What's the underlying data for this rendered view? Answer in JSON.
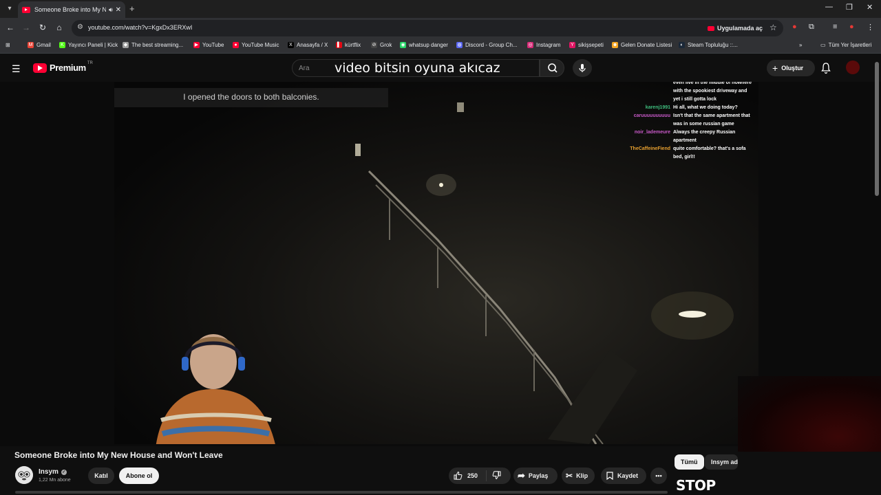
{
  "browser": {
    "tab_title": "Someone Broke into My Ne",
    "url": "youtube.com/watch?v=KgxDx3ERXwI",
    "open_in_app": "Uygulamada aç",
    "bookmarks": [
      {
        "label": "Gmail",
        "color": "#ea4335",
        "icon": "M"
      },
      {
        "label": "Yayıncı Paneli | Kick",
        "color": "#53fc18",
        "icon": "K"
      },
      {
        "label": "The best streaming...",
        "color": "#9e9e9e",
        "icon": "◆"
      },
      {
        "label": "YouTube",
        "color": "#ff0033",
        "icon": "▶"
      },
      {
        "label": "YouTube Music",
        "color": "#ff0033",
        "icon": "●"
      },
      {
        "label": "Anasayfa / X",
        "color": "#000000",
        "icon": "X"
      },
      {
        "label": "kürtflix",
        "color": "#e50914",
        "icon": "▌"
      },
      {
        "label": "Grok",
        "color": "#444444",
        "icon": "⊘"
      },
      {
        "label": "whatsup danger",
        "color": "#25d366",
        "icon": "◉"
      },
      {
        "label": "Discord - Group Ch...",
        "color": "#5865f2",
        "icon": "◍"
      },
      {
        "label": "Instagram",
        "color": "#d62976",
        "icon": "◎"
      },
      {
        "label": "sikişsepeti",
        "color": "#e01563",
        "icon": "Y"
      },
      {
        "label": "Gelen Donate Listesi",
        "color": "#f5a623",
        "icon": "☻"
      },
      {
        "label": "Steam Topluluğu ::...",
        "color": "#1b2838",
        "icon": "◐"
      }
    ],
    "all_bookmarks": "Tüm Yer İşaretleri"
  },
  "youtube": {
    "logo_text": "Premium",
    "country": "TR",
    "search_placeholder": "Ara",
    "search_query": "video bitsin oyuna akıcaz",
    "create_label": "Oluştur"
  },
  "video": {
    "caption": "I opened the doors to both balconies.",
    "chat": [
      {
        "user": "",
        "color": "#ffffff",
        "msg": "even live in the middle of nowhere"
      },
      {
        "user": "",
        "color": "#ffffff",
        "msg": "with the spookiest driveway and"
      },
      {
        "user": "",
        "color": "#ffffff",
        "msg": "yet i still gotta lock"
      },
      {
        "user": "karenj1991",
        "color": "#3fbf7f",
        "msg": "Hi all, what we doing today?"
      },
      {
        "user": "caruuuuuuuuuu",
        "color": "#c85ac8",
        "msg": "Isn't that the same apartment that"
      },
      {
        "user": "",
        "color": "#ffffff",
        "msg": "was in some russian game"
      },
      {
        "user": "noir_lademeure",
        "color": "#c85ac8",
        "msg": "Always the creepy Russian"
      },
      {
        "user": "",
        "color": "#ffffff",
        "msg": "apartment"
      },
      {
        "user": "TheCaffeineFiend",
        "color": "#e8a030",
        "msg": "quite comfortable? that's a sofa"
      },
      {
        "user": "",
        "color": "#ffffff",
        "msg": "bed, girl!!"
      }
    ],
    "title": "Someone Broke into My New House and Won't Leave",
    "channel": "Insym",
    "subscribers": "1,22 Mn abone",
    "join_label": "Katıl",
    "subscribe_label": "Abone ol",
    "likes": "250",
    "share_label": "Paylaş",
    "clip_label": "Klip",
    "save_label": "Kaydet"
  },
  "sidebar": {
    "chips": [
      "Tümü",
      "Insym adl"
    ],
    "thumb_text": "STOP"
  }
}
